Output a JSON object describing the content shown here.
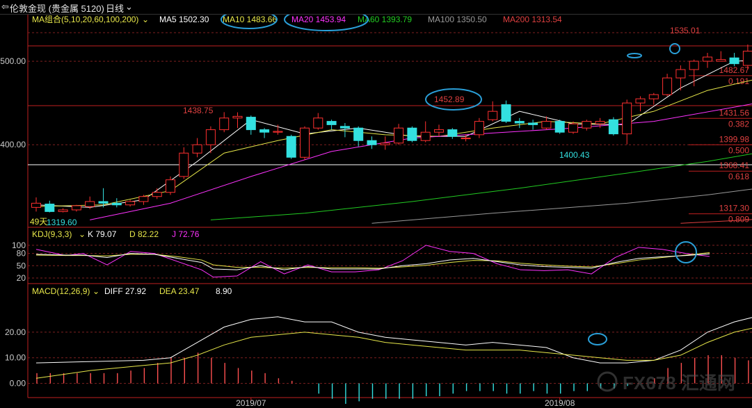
{
  "header": {
    "back_arrow": "⇦",
    "title": "伦敦金现 (贵金属  5120)",
    "period": "日线",
    "period_caret": "⌄"
  },
  "ma_legend": {
    "label": "MA组合(5,10,20,60,100,200)",
    "items": [
      {
        "text": "MA5 1502.30",
        "color": "#ffffff"
      },
      {
        "text": "MA10 1483.66",
        "color": "#e8e84a"
      },
      {
        "text": "MA20 1453.94",
        "color": "#ff33ff"
      },
      {
        "text": "MA60 1393.79",
        "color": "#22cc22"
      },
      {
        "text": "MA100 1350.50",
        "color": "#9a9a9a"
      },
      {
        "text": "MA200 1313.54",
        "color": "#e04040"
      }
    ]
  },
  "kdj_legend": {
    "label": "KDJ(9,3,3)",
    "items": [
      {
        "text": "K 79.07",
        "color": "#ffffff"
      },
      {
        "text": "D 82.22",
        "color": "#e8e84a"
      },
      {
        "text": "J 72.76",
        "color": "#ff33ff"
      }
    ]
  },
  "macd_legend": {
    "label": "MACD(12,26,9)",
    "items": [
      {
        "text": "DIFF 27.92",
        "color": "#ffffff"
      },
      {
        "text": "DEA 23.47",
        "color": "#e8e84a"
      },
      {
        "text": "8.90",
        "color": "#ffffff"
      }
    ]
  },
  "annotations": {
    "high_label": "1535.01",
    "peak1": "1438.75",
    "peak2": "1452.89",
    "low_label": "1400.43",
    "start_label_prefix": "49天",
    "start_label": "1319.60"
  },
  "axes": {
    "price_ticks": [
      {
        "label": "500.00",
        "value": 1500
      },
      {
        "label": "400.00",
        "value": 1400
      }
    ],
    "kdj_ticks": [
      {
        "label": "100",
        "value": 100
      },
      {
        "label": "80",
        "value": 80
      },
      {
        "label": "50",
        "value": 50
      },
      {
        "label": "20",
        "value": 20
      }
    ],
    "macd_ticks": [
      {
        "label": "20.00",
        "value": 20
      },
      {
        "label": "10.00",
        "value": 10
      },
      {
        "label": "0.00",
        "value": 0
      }
    ],
    "date_labels": [
      {
        "label": "2019/07",
        "index": 16
      },
      {
        "label": "2019/08",
        "index": 39
      }
    ]
  },
  "chart_data": {
    "type": "candlestick",
    "instrument": "伦敦金现",
    "period": "日线",
    "fib_levels": [
      {
        "price": "1482.67",
        "ratio": "0.191",
        "value": 1482.67
      },
      {
        "price": "1431.56",
        "ratio": "0.382",
        "value": 1431.56
      },
      {
        "price": "1399.98",
        "ratio": "0.500",
        "value": 1399.98
      },
      {
        "price": "1368.41",
        "ratio": "0.618",
        "value": 1368.41
      },
      {
        "price": "1317.30",
        "ratio": "0.809",
        "value": 1317.3
      }
    ],
    "candles": [
      [
        1325,
        1330,
        1337,
        1320
      ],
      [
        1329,
        1320,
        1333,
        1319
      ],
      [
        1320,
        1322,
        1324,
        1319
      ],
      [
        1322,
        1327,
        1328,
        1320
      ],
      [
        1326,
        1332,
        1338,
        1323
      ],
      [
        1332,
        1330,
        1348,
        1325
      ],
      [
        1330,
        1328,
        1336,
        1325
      ],
      [
        1328,
        1332,
        1334,
        1326
      ],
      [
        1332,
        1338,
        1340,
        1328
      ],
      [
        1338,
        1343,
        1348,
        1335
      ],
      [
        1343,
        1358,
        1362,
        1340
      ],
      [
        1362,
        1390,
        1397,
        1359
      ],
      [
        1390,
        1400,
        1408,
        1385
      ],
      [
        1400,
        1418,
        1422,
        1390
      ],
      [
        1418,
        1432,
        1439,
        1415
      ],
      [
        1432,
        1434,
        1438.75,
        1420
      ],
      [
        1433,
        1418,
        1435,
        1412
      ],
      [
        1418,
        1415,
        1420,
        1408
      ],
      [
        1415,
        1416,
        1424,
        1412
      ],
      [
        1410,
        1385,
        1412,
        1383
      ],
      [
        1385,
        1420,
        1422,
        1382
      ],
      [
        1420,
        1432,
        1438,
        1418
      ],
      [
        1428,
        1424,
        1430,
        1418
      ],
      [
        1422,
        1420,
        1426,
        1409
      ],
      [
        1420,
        1405,
        1422,
        1398
      ],
      [
        1405,
        1400,
        1410,
        1395
      ],
      [
        1400,
        1402,
        1410,
        1394
      ],
      [
        1402,
        1420,
        1425,
        1400
      ],
      [
        1420,
        1405,
        1422,
        1403
      ],
      [
        1405,
        1415,
        1428,
        1403
      ],
      [
        1415,
        1418,
        1424,
        1410
      ],
      [
        1418,
        1410,
        1420,
        1407
      ],
      [
        1408,
        1408,
        1412,
        1404
      ],
      [
        1412,
        1428,
        1432,
        1408
      ],
      [
        1430,
        1440,
        1452,
        1428
      ],
      [
        1448,
        1428,
        1452.89,
        1426
      ],
      [
        1428,
        1426,
        1432,
        1420
      ],
      [
        1426,
        1424,
        1430,
        1418
      ],
      [
        1420,
        1428,
        1434,
        1418
      ],
      [
        1428,
        1415,
        1430,
        1413
      ],
      [
        1415,
        1425,
        1428,
        1413
      ],
      [
        1420,
        1428,
        1430,
        1417
      ],
      [
        1425,
        1428,
        1432,
        1420
      ],
      [
        1430,
        1413,
        1433,
        1411
      ],
      [
        1413,
        1450,
        1454,
        1400.43
      ],
      [
        1450,
        1455,
        1458,
        1440
      ],
      [
        1455,
        1460,
        1462,
        1448
      ],
      [
        1460,
        1480,
        1485,
        1458
      ],
      [
        1480,
        1490,
        1495,
        1465
      ],
      [
        1490,
        1500,
        1502,
        1470
      ],
      [
        1500,
        1505,
        1510,
        1492
      ],
      [
        1500,
        1502,
        1512,
        1500
      ],
      [
        1504,
        1497,
        1510,
        1494
      ],
      [
        1495,
        1512,
        1520,
        1490
      ],
      [
        1510,
        1500,
        1535.01,
        1478
      ],
      [
        1500,
        1502,
        1506,
        1490
      ]
    ],
    "ma_series": [
      {
        "key": "MA5",
        "color": "#ffffff",
        "values": [
          [
            0,
            1328
          ],
          [
            4,
            1325
          ],
          [
            8,
            1334
          ],
          [
            12,
            1380
          ],
          [
            16,
            1430
          ],
          [
            20,
            1413
          ],
          [
            24,
            1420
          ],
          [
            28,
            1410
          ],
          [
            32,
            1410
          ],
          [
            36,
            1440
          ],
          [
            40,
            1425
          ],
          [
            44,
            1424
          ],
          [
            48,
            1468
          ],
          [
            52,
            1500
          ],
          [
            55,
            1502.3
          ]
        ]
      },
      {
        "key": "MA10",
        "color": "#e8e84a",
        "values": [
          [
            0,
            1326
          ],
          [
            5,
            1328
          ],
          [
            10,
            1345
          ],
          [
            14,
            1390
          ],
          [
            18,
            1405
          ],
          [
            22,
            1418
          ],
          [
            26,
            1412
          ],
          [
            30,
            1410
          ],
          [
            34,
            1420
          ],
          [
            38,
            1428
          ],
          [
            42,
            1425
          ],
          [
            46,
            1440
          ],
          [
            50,
            1465
          ],
          [
            55,
            1483.66
          ]
        ]
      },
      {
        "key": "MA20",
        "color": "#ff33ff",
        "values": [
          [
            4,
            1310
          ],
          [
            10,
            1330
          ],
          [
            16,
            1362
          ],
          [
            22,
            1392
          ],
          [
            28,
            1408
          ],
          [
            34,
            1414
          ],
          [
            40,
            1420
          ],
          [
            46,
            1428
          ],
          [
            52,
            1445
          ],
          [
            55,
            1453.94
          ]
        ]
      },
      {
        "key": "MA60",
        "color": "#22cc22",
        "values": [
          [
            13,
            1310
          ],
          [
            20,
            1318
          ],
          [
            28,
            1332
          ],
          [
            36,
            1348
          ],
          [
            44,
            1366
          ],
          [
            50,
            1380
          ],
          [
            55,
            1393.79
          ]
        ]
      },
      {
        "key": "MA100",
        "color": "#9a9a9a",
        "values": [
          [
            25,
            1306
          ],
          [
            34,
            1318
          ],
          [
            44,
            1330
          ],
          [
            50,
            1340
          ],
          [
            55,
            1350.5
          ]
        ]
      },
      {
        "key": "MA200",
        "color": "#e04040",
        "values": [
          [
            48,
            1306
          ],
          [
            53,
            1310
          ],
          [
            55,
            1313.54
          ]
        ]
      }
    ],
    "kdj": {
      "K": [
        [
          0,
          78
        ],
        [
          5,
          76
        ],
        [
          8,
          76
        ],
        [
          12,
          70
        ],
        [
          16,
          80
        ],
        [
          20,
          78
        ],
        [
          24,
          68
        ],
        [
          28,
          58
        ],
        [
          30,
          42
        ],
        [
          34,
          40
        ],
        [
          38,
          50
        ],
        [
          42,
          40
        ],
        [
          46,
          48
        ],
        [
          50,
          42
        ],
        [
          54,
          42
        ],
        [
          58,
          42
        ],
        [
          62,
          50
        ],
        [
          66,
          55
        ],
        [
          70,
          64
        ],
        [
          74,
          68
        ],
        [
          78,
          60
        ],
        [
          82,
          52
        ],
        [
          86,
          48
        ],
        [
          90,
          46
        ],
        [
          94,
          44
        ],
        [
          98,
          58
        ],
        [
          102,
          68
        ],
        [
          106,
          72
        ],
        [
          110,
          75
        ],
        [
          114,
          79
        ]
      ],
      "D": [
        [
          0,
          76
        ],
        [
          5,
          75
        ],
        [
          8,
          75
        ],
        [
          12,
          74
        ],
        [
          16,
          78
        ],
        [
          20,
          78
        ],
        [
          24,
          72
        ],
        [
          28,
          64
        ],
        [
          30,
          52
        ],
        [
          34,
          46
        ],
        [
          38,
          46
        ],
        [
          42,
          44
        ],
        [
          46,
          46
        ],
        [
          50,
          45
        ],
        [
          54,
          45
        ],
        [
          58,
          44
        ],
        [
          62,
          47
        ],
        [
          66,
          51
        ],
        [
          70,
          58
        ],
        [
          74,
          63
        ],
        [
          78,
          62
        ],
        [
          82,
          56
        ],
        [
          86,
          52
        ],
        [
          90,
          49
        ],
        [
          94,
          47
        ],
        [
          98,
          55
        ],
        [
          102,
          64
        ],
        [
          106,
          70
        ],
        [
          110,
          76
        ],
        [
          114,
          82
        ]
      ],
      "J": [
        [
          0,
          90
        ],
        [
          5,
          75
        ],
        [
          8,
          80
        ],
        [
          12,
          52
        ],
        [
          16,
          85
        ],
        [
          20,
          80
        ],
        [
          24,
          60
        ],
        [
          28,
          40
        ],
        [
          30,
          22
        ],
        [
          34,
          25
        ],
        [
          38,
          60
        ],
        [
          42,
          30
        ],
        [
          46,
          52
        ],
        [
          50,
          35
        ],
        [
          54,
          35
        ],
        [
          58,
          40
        ],
        [
          62,
          62
        ],
        [
          66,
          100
        ],
        [
          70,
          85
        ],
        [
          74,
          80
        ],
        [
          78,
          55
        ],
        [
          82,
          40
        ],
        [
          86,
          38
        ],
        [
          90,
          40
        ],
        [
          94,
          30
        ],
        [
          98,
          70
        ],
        [
          102,
          95
        ],
        [
          106,
          90
        ],
        [
          110,
          80
        ],
        [
          114,
          72.76
        ]
      ]
    },
    "macd": {
      "DIFF": [
        [
          0,
          8
        ],
        [
          4,
          8.5
        ],
        [
          8,
          9
        ],
        [
          10,
          10
        ],
        [
          12,
          16
        ],
        [
          14,
          22
        ],
        [
          16,
          25
        ],
        [
          18,
          26
        ],
        [
          20,
          24
        ],
        [
          22,
          24
        ],
        [
          24,
          20
        ],
        [
          26,
          18
        ],
        [
          28,
          17
        ],
        [
          30,
          16
        ],
        [
          32,
          15
        ],
        [
          34,
          16
        ],
        [
          36,
          15
        ],
        [
          38,
          14
        ],
        [
          40,
          10
        ],
        [
          42,
          8
        ],
        [
          44,
          8
        ],
        [
          46,
          9
        ],
        [
          48,
          13
        ],
        [
          50,
          20
        ],
        [
          52,
          24
        ],
        [
          55,
          27.92
        ]
      ],
      "DEA": [
        [
          0,
          2
        ],
        [
          4,
          5
        ],
        [
          8,
          7
        ],
        [
          10,
          8
        ],
        [
          12,
          11
        ],
        [
          14,
          15
        ],
        [
          16,
          18
        ],
        [
          18,
          19
        ],
        [
          20,
          20
        ],
        [
          22,
          19
        ],
        [
          24,
          18
        ],
        [
          26,
          16
        ],
        [
          28,
          15
        ],
        [
          30,
          14
        ],
        [
          32,
          13
        ],
        [
          34,
          13
        ],
        [
          36,
          13
        ],
        [
          38,
          12
        ],
        [
          40,
          11
        ],
        [
          42,
          10
        ],
        [
          44,
          9
        ],
        [
          46,
          9
        ],
        [
          48,
          11
        ],
        [
          50,
          16
        ],
        [
          52,
          20
        ],
        [
          55,
          23.47
        ]
      ]
    },
    "macd_hist": [
      4,
      4,
      4,
      4,
      4,
      4,
      4,
      5,
      6,
      8,
      10,
      10,
      12,
      10,
      8,
      6,
      5,
      4,
      2,
      1,
      0,
      -4,
      -6,
      -8,
      -7,
      -6,
      -6,
      -6,
      -6,
      -5,
      -5,
      -4,
      -3,
      -3,
      -3,
      -4,
      -4,
      -3,
      -4,
      -4,
      -3,
      -3,
      -2,
      -2,
      -1,
      0,
      2,
      6,
      8,
      10,
      11,
      11,
      10,
      9,
      9
    ]
  }
}
